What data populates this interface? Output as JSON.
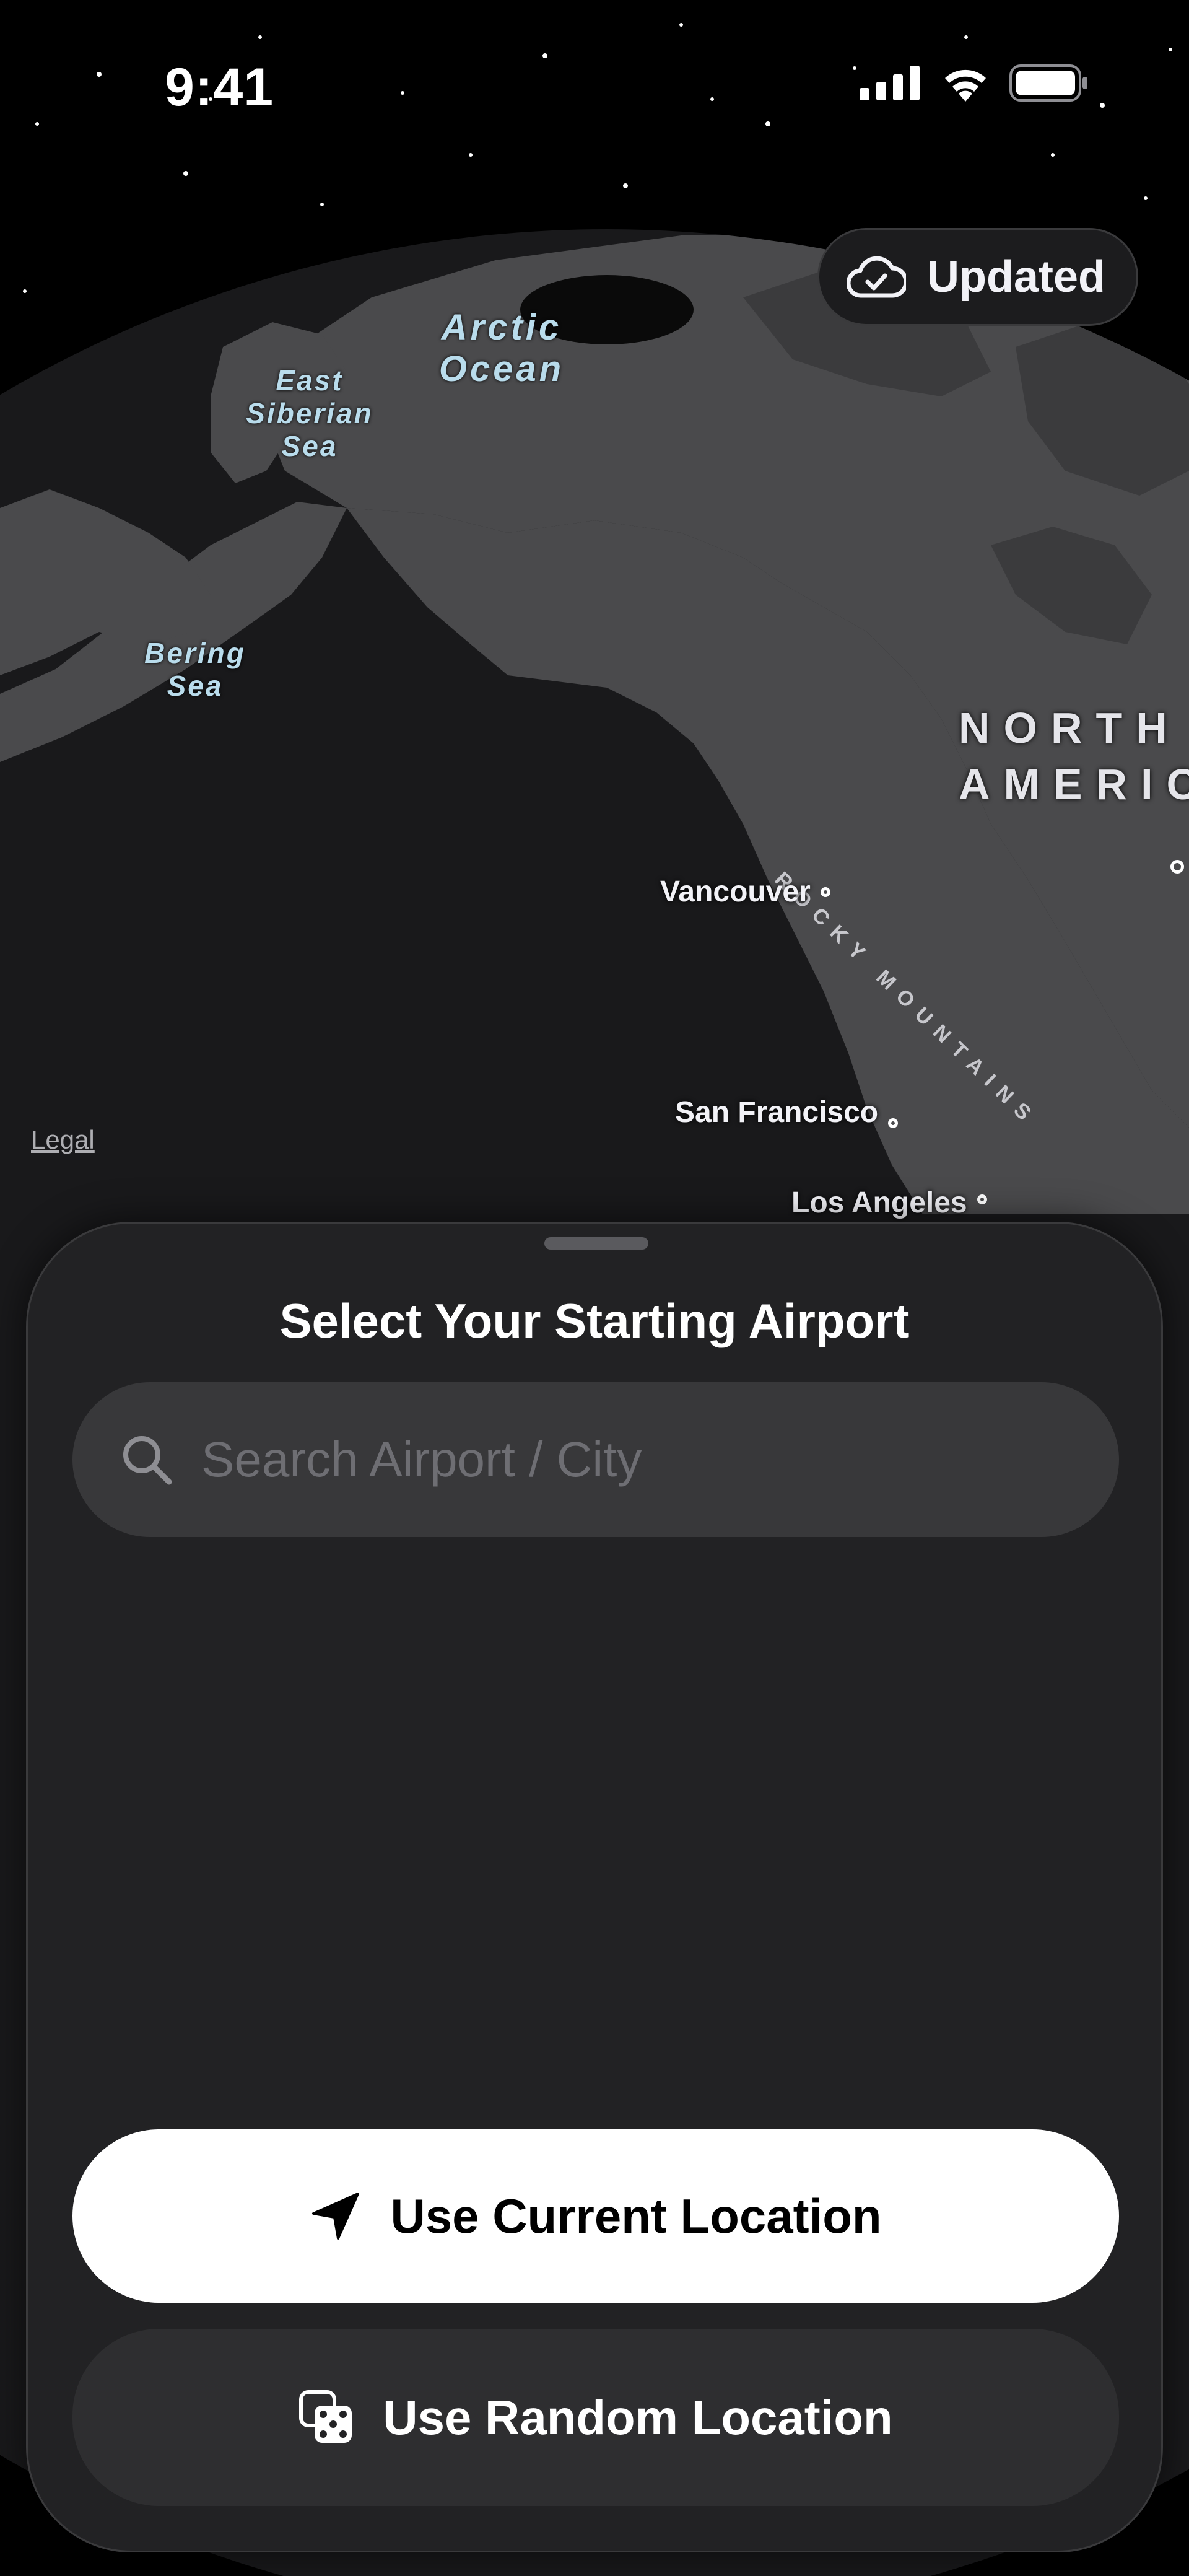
{
  "status_bar": {
    "time": "9:41"
  },
  "sync_badge": {
    "label": "Updated",
    "icon": "cloud-checkmark-icon"
  },
  "map": {
    "oceans": [
      "Arctic",
      "Ocean"
    ],
    "seas": {
      "east_siberian": [
        "East",
        "Siberian",
        "Sea"
      ],
      "bering": [
        "Bering",
        "Sea"
      ]
    },
    "continent": [
      "NORTH",
      "AMERIC"
    ],
    "mountain_range": "ROCKY MOUNTAINS",
    "cities": {
      "vancouver": "Vancouver",
      "san_francisco": "San Francisco",
      "los_angeles": "Los Angeles"
    },
    "legal_link": "Legal"
  },
  "sheet": {
    "title": "Select Your Starting Airport",
    "search": {
      "placeholder": "Search Airport / City",
      "icon": "magnifying-glass-icon"
    },
    "primary_button": {
      "label": "Use Current Location",
      "icon": "location-arrow-icon"
    },
    "secondary_button": {
      "label": "Use Random Location",
      "icon": "dice-icon"
    }
  },
  "colors": {
    "background": "#000000",
    "land": "#4a4a4c",
    "ocean": "#19191b",
    "sheet": "#222224",
    "search_field": "#38383a",
    "primary_button": "#ffffff",
    "secondary_button": "#2e2e30",
    "water_label": "#b9dcec"
  }
}
